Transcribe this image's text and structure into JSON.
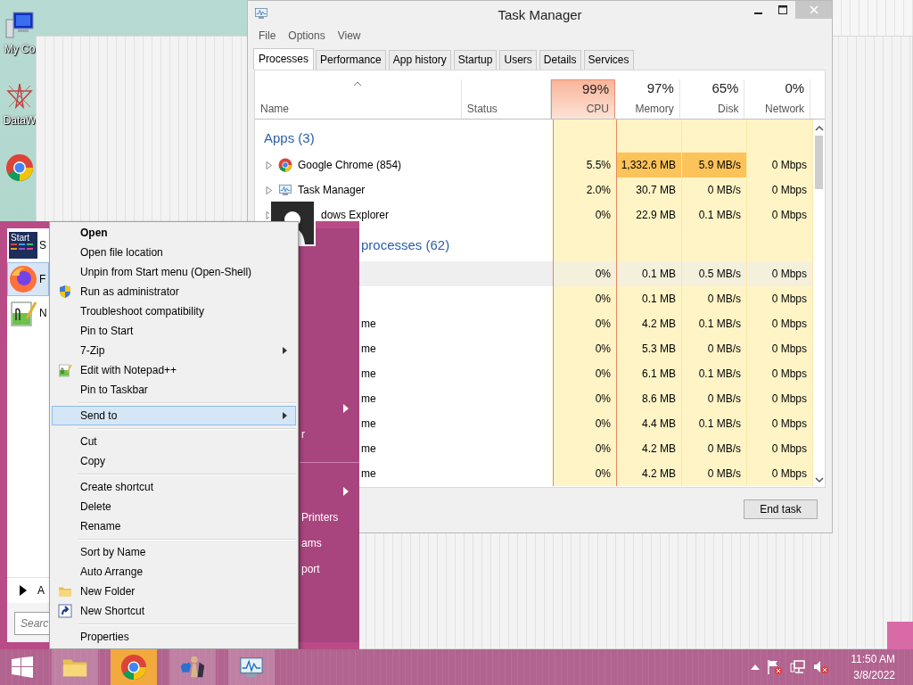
{
  "desktop": {
    "icons": [
      {
        "kind": "computer",
        "label": "My Co"
      },
      {
        "kind": "star",
        "label": "DataW"
      },
      {
        "kind": "browser"
      }
    ]
  },
  "task_manager": {
    "title": "Task Manager",
    "menu": [
      "File",
      "Options",
      "View"
    ],
    "tabs": [
      {
        "label": "Processes",
        "selected": true
      },
      {
        "label": "Performance",
        "selected": false
      },
      {
        "label": "App history",
        "selected": false
      },
      {
        "label": "Startup",
        "selected": false
      },
      {
        "label": "Users",
        "selected": false
      },
      {
        "label": "Details",
        "selected": false
      },
      {
        "label": "Services",
        "selected": false
      }
    ],
    "columns": [
      {
        "label": "Name",
        "sorted": true
      },
      {
        "label": "Status",
        "sorted": false
      },
      {
        "usage": "99%",
        "label": "CPU",
        "highlighted": true
      },
      {
        "usage": "97%",
        "label": "Memory",
        "highlighted": false
      },
      {
        "usage": "65%",
        "label": "Disk",
        "highlighted": false
      },
      {
        "usage": "0%",
        "label": "Network",
        "highlighted": false
      }
    ],
    "rows": [
      {
        "kind": "group",
        "title": "Apps (3)"
      },
      {
        "kind": "process",
        "name": "Google Chrome (854)",
        "expandable": true,
        "selected": false,
        "cells": [
          {
            "text": "5.5%",
            "hot": false
          },
          {
            "text": "1,332.6 MB",
            "hot": true
          },
          {
            "text": "5.9 MB/s",
            "hot": true
          },
          {
            "text": "0 Mbps",
            "hot": false
          }
        ]
      },
      {
        "kind": "process",
        "name": "Task Manager",
        "expandable": true,
        "selected": false,
        "cells": [
          {
            "text": "2.0%",
            "hot": false
          },
          {
            "text": "30.7 MB",
            "hot": false
          },
          {
            "text": "0 MB/s",
            "hot": false
          },
          {
            "text": "0 Mbps",
            "hot": false
          }
        ]
      },
      {
        "kind": "process",
        "name": "dows Explorer",
        "expandable": true,
        "selected": false,
        "cells": [
          {
            "text": "0%",
            "hot": false
          },
          {
            "text": "22.9 MB",
            "hot": false
          },
          {
            "text": "0.1 MB/s",
            "hot": false
          },
          {
            "text": "0 Mbps",
            "hot": false
          }
        ]
      },
      {
        "kind": "covered-group",
        "title": "processes (62)"
      },
      {
        "kind": "covered-process",
        "selected": true,
        "cells": [
          {
            "text": "0%",
            "hot": false
          },
          {
            "text": "0.1 MB",
            "hot": false
          },
          {
            "text": "0.5 MB/s",
            "hot": false
          },
          {
            "text": "0 Mbps",
            "hot": false
          }
        ]
      },
      {
        "kind": "covered-process",
        "selected": false,
        "cells": [
          {
            "text": "0%",
            "hot": false
          },
          {
            "text": "0.1 MB",
            "hot": false
          },
          {
            "text": "0 MB/s",
            "hot": false
          },
          {
            "text": "0 Mbps",
            "hot": false
          }
        ]
      },
      {
        "kind": "covered-process",
        "name": "me",
        "selected": false,
        "cells": [
          {
            "text": "0%",
            "hot": false
          },
          {
            "text": "4.2 MB",
            "hot": false
          },
          {
            "text": "0.1 MB/s",
            "hot": false
          },
          {
            "text": "0 Mbps",
            "hot": false
          }
        ]
      },
      {
        "kind": "covered-process",
        "name": "me",
        "selected": false,
        "cells": [
          {
            "text": "0%",
            "hot": false
          },
          {
            "text": "5.3 MB",
            "hot": false
          },
          {
            "text": "0 MB/s",
            "hot": false
          },
          {
            "text": "0 Mbps",
            "hot": false
          }
        ]
      },
      {
        "kind": "covered-process",
        "name": "me",
        "selected": false,
        "cells": [
          {
            "text": "0%",
            "hot": false
          },
          {
            "text": "6.1 MB",
            "hot": false
          },
          {
            "text": "0.1 MB/s",
            "hot": false
          },
          {
            "text": "0 Mbps",
            "hot": false
          }
        ]
      },
      {
        "kind": "covered-process",
        "name": "me",
        "selected": false,
        "cells": [
          {
            "text": "0%",
            "hot": false
          },
          {
            "text": "8.6 MB",
            "hot": false
          },
          {
            "text": "0 MB/s",
            "hot": false
          },
          {
            "text": "0 Mbps",
            "hot": false
          }
        ]
      },
      {
        "kind": "covered-process",
        "name": "me",
        "selected": false,
        "cells": [
          {
            "text": "0%",
            "hot": false
          },
          {
            "text": "4.4 MB",
            "hot": false
          },
          {
            "text": "0.1 MB/s",
            "hot": false
          },
          {
            "text": "0 Mbps",
            "hot": false
          }
        ]
      },
      {
        "kind": "covered-process",
        "name": "me",
        "selected": false,
        "cells": [
          {
            "text": "0%",
            "hot": false
          },
          {
            "text": "4.2 MB",
            "hot": false
          },
          {
            "text": "0 MB/s",
            "hot": false
          },
          {
            "text": "0 Mbps",
            "hot": false
          }
        ]
      },
      {
        "kind": "covered-process",
        "name": "me",
        "selected": false,
        "cells": [
          {
            "text": "0%",
            "hot": false
          },
          {
            "text": "4.2 MB",
            "hot": false
          },
          {
            "text": "0 MB/s",
            "hot": false
          },
          {
            "text": "0 Mbps",
            "hot": false
          }
        ]
      }
    ],
    "end_task": "End task"
  },
  "start_menu": {
    "items": [
      {
        "tile_text": "Start",
        "label": "S",
        "selected": false
      },
      {
        "label": "F",
        "selected": true
      },
      {
        "label": "N",
        "selected": false
      }
    ],
    "all_programs": "A",
    "search": {
      "placeholder": "Searc"
    },
    "right_items": [
      {
        "kind": "submenu"
      },
      {
        "kind": "item",
        "label": "r"
      },
      {
        "kind": "separator"
      },
      {
        "kind": "submenu"
      },
      {
        "kind": "item",
        "label": "Printers"
      },
      {
        "kind": "item",
        "label": "ams"
      },
      {
        "kind": "item",
        "label": "port"
      }
    ]
  },
  "context_menu": {
    "sections": [
      [
        {
          "label": "Open",
          "default": true,
          "submenu": false,
          "selected": false
        },
        {
          "label": "Open file location",
          "default": false,
          "submenu": false,
          "selected": false
        },
        {
          "label": "Unpin from Start menu (Open-Shell)",
          "default": false,
          "submenu": false,
          "selected": false
        },
        {
          "label": "Run as administrator",
          "kind": "shield",
          "default": false,
          "submenu": false,
          "selected": false
        },
        {
          "label": "Troubleshoot compatibility",
          "default": false,
          "submenu": false,
          "selected": false
        },
        {
          "label": "Pin to Start",
          "default": false,
          "submenu": false,
          "selected": false
        },
        {
          "label": "7-Zip",
          "default": false,
          "submenu": true,
          "selected": false
        },
        {
          "label": "Edit with Notepad++",
          "kind": "notepad",
          "default": false,
          "submenu": false,
          "selected": false
        },
        {
          "label": "Pin to Taskbar",
          "default": false,
          "submenu": false,
          "selected": false
        }
      ],
      [
        {
          "label": "Send to",
          "default": false,
          "submenu": true,
          "selected": true
        }
      ],
      [
        {
          "label": "Cut",
          "default": false,
          "submenu": false,
          "selected": false
        },
        {
          "label": "Copy",
          "default": false,
          "submenu": false,
          "selected": false
        }
      ],
      [
        {
          "label": "Create shortcut",
          "default": false,
          "submenu": false,
          "selected": false
        },
        {
          "label": "Delete",
          "default": false,
          "submenu": false,
          "selected": false
        },
        {
          "label": "Rename",
          "default": false,
          "submenu": false,
          "selected": false
        }
      ],
      [
        {
          "label": "Sort by Name",
          "default": false,
          "submenu": false,
          "selected": false
        },
        {
          "label": "Auto Arrange",
          "default": false,
          "submenu": false,
          "selected": false
        },
        {
          "label": "New Folder",
          "kind": "folder",
          "default": false,
          "submenu": false,
          "selected": false
        },
        {
          "label": "New Shortcut",
          "kind": "shortcut",
          "default": false,
          "submenu": false,
          "selected": false
        }
      ],
      [
        {
          "label": "Properties",
          "default": false,
          "submenu": false,
          "selected": false
        }
      ]
    ]
  },
  "taskbar": {
    "apps": [
      {
        "active": false
      },
      {
        "active": true
      },
      {
        "active": false
      },
      {
        "active": false
      }
    ],
    "tray": {
      "time": "11:50 AM",
      "date": "3/8/2022"
    }
  }
}
